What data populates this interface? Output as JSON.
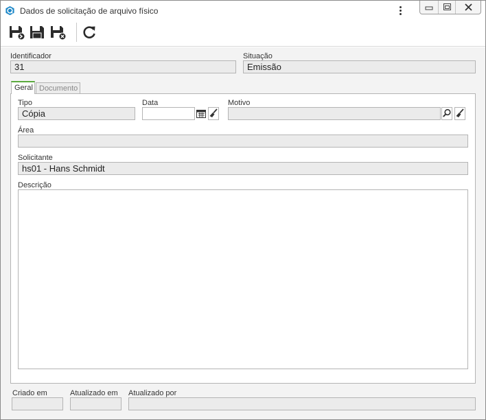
{
  "window": {
    "title": "Dados de solicitação de arquivo físico"
  },
  "toolbar": {
    "buttons": [
      {
        "name": "save-and-new",
        "icon": "floppy-plus-icon"
      },
      {
        "name": "save",
        "icon": "floppy-icon"
      },
      {
        "name": "save-and-close",
        "icon": "floppy-close-icon"
      },
      {
        "name": "refresh",
        "icon": "refresh-icon"
      }
    ]
  },
  "header": {
    "identificador_label": "Identificador",
    "identificador_value": "31",
    "situacao_label": "Situação",
    "situacao_value": "Emissão"
  },
  "tabs": [
    {
      "label": "Geral",
      "active": true
    },
    {
      "label": "Documento",
      "active": false
    }
  ],
  "geral": {
    "tipo_label": "Tipo",
    "tipo_value": "Cópia",
    "data_label": "Data",
    "data_value": "",
    "motivo_label": "Motivo",
    "motivo_value": "",
    "area_label": "Área",
    "area_value": "",
    "solicitante_label": "Solicitante",
    "solicitante_value": "hs01 - Hans Schmidt",
    "descricao_label": "Descrição",
    "descricao_value": ""
  },
  "footer": {
    "criado_em_label": "Criado em",
    "criado_em_value": "",
    "atualizado_em_label": "Atualizado em",
    "atualizado_em_value": "",
    "atualizado_por_label": "Atualizado por",
    "atualizado_por_value": ""
  },
  "colors": {
    "accent": "#5aaa3c",
    "app_icon": "#1e88c8",
    "field_bg": "#ebebeb",
    "content_bg": "#f3f3f3"
  }
}
